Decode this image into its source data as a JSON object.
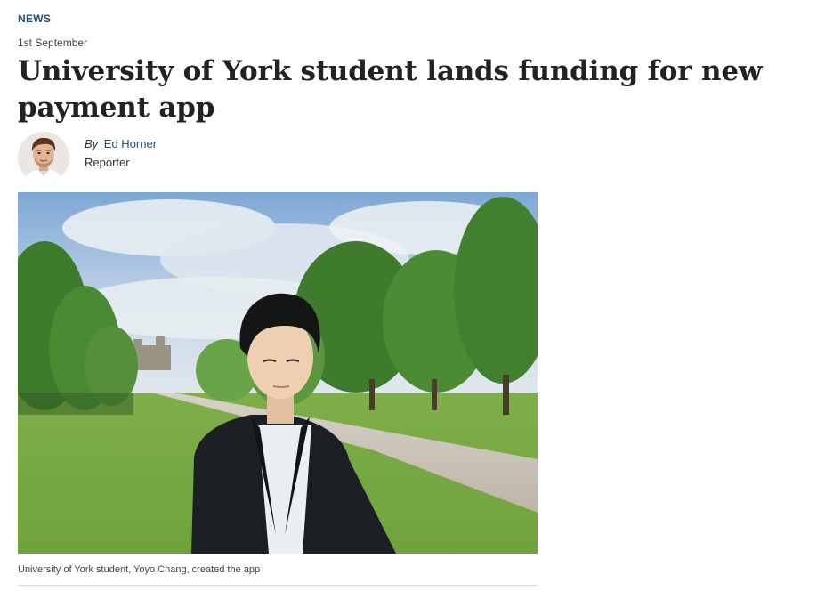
{
  "article": {
    "section": "NEWS",
    "date": "1st September",
    "headline": "University of York student lands funding for new payment app",
    "byline": {
      "by_prefix": "By",
      "author_name": "Ed Horner",
      "author_role": "Reporter"
    },
    "image": {
      "caption": "University of York student, Yoyo Chang, created the app"
    }
  },
  "colors": {
    "link_blue": "#1d4f7a",
    "divider": "#d7d7d7"
  }
}
